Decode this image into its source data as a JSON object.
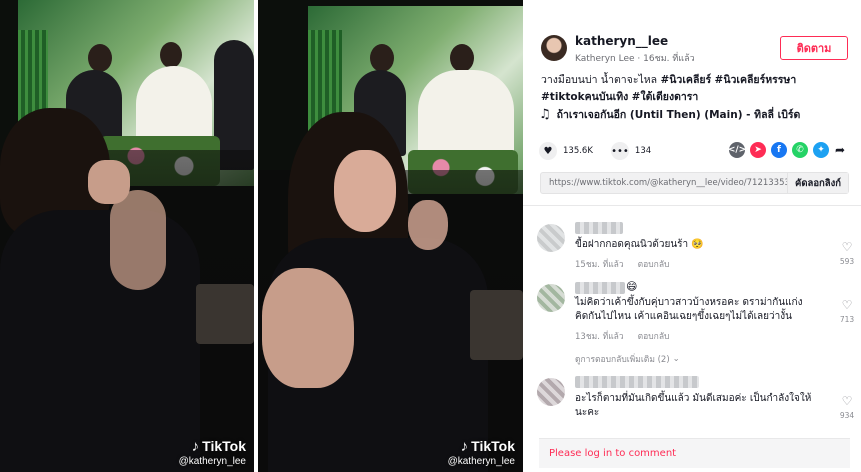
{
  "videos": [
    {
      "watermark_brand": "TikTok",
      "watermark_handle": "@katheryn_lee"
    },
    {
      "watermark_brand": "TikTok",
      "watermark_handle": "@katheryn_lee"
    }
  ],
  "author": {
    "username": "katheryn__lee",
    "display_line": "Katheryn Lee · 16ชม. ที่แล้ว",
    "follow_label": "ติดตาม"
  },
  "caption": {
    "text": "วางมือบนบ่า น้ำตาจะไหล",
    "hashtags": [
      "#นิวเคลียร์",
      "#นิวเคลียร์หรรษา",
      "#tiktokคนบันเทิง",
      "#ใต้เตียงดารา"
    ]
  },
  "music": {
    "title": "ถ้าเราเจอกันอีก (Until Then) (Main) - ทิลลี่ เบิร์ด"
  },
  "stats": {
    "likes": "135.6K",
    "comments": "134"
  },
  "share": {
    "link": "https://www.tiktok.com/@katheryn__lee/video/7121335313...",
    "copy_label": "คัดลอกลิงก์"
  },
  "comments": [
    {
      "text": "ขื้อฝากกอดคุณนิวด้วยนร้า 🥺",
      "time": "15ชม. ที่แล้ว",
      "reply_label": "ตอบกลับ",
      "likes": "593"
    },
    {
      "name_emoji": "😄",
      "text": "ไม่คิดว่าเค้าขึ้งกับคุ่บาวสาวบ้างหรอคะ ดราม่ากันแก่งคิดกันไปไหน เค้าแคอินเฉยๆขึ้งเฉยๆไม่ได้เลยว่างั้น",
      "time": "13ชม. ที่แล้ว",
      "reply_label": "ตอบกลับ",
      "likes": "713"
    },
    {
      "text": "อะไรก็ตามที่มันเกิดขึ้นแล้ว มันดีเสมอค่ะ เป็นกำลังใจให้นะคะ",
      "likes": "934"
    }
  ],
  "view_more_replies": "ดูการตอบกลับเพิ่มเติม (2)",
  "login_prompt": "Please log in to comment",
  "colors": {
    "accent": "#fe2c55",
    "facebook": "#1877f2",
    "whatsapp": "#25d366",
    "twitter": "#1da1f2"
  },
  "icons": [
    "music-note-icon",
    "heart-icon",
    "comment-icon",
    "embed-icon",
    "send-icon",
    "facebook-icon",
    "whatsapp-icon",
    "twitter-icon",
    "share-arrow-icon",
    "chevron-down-icon",
    "tiktok-logo-icon"
  ]
}
